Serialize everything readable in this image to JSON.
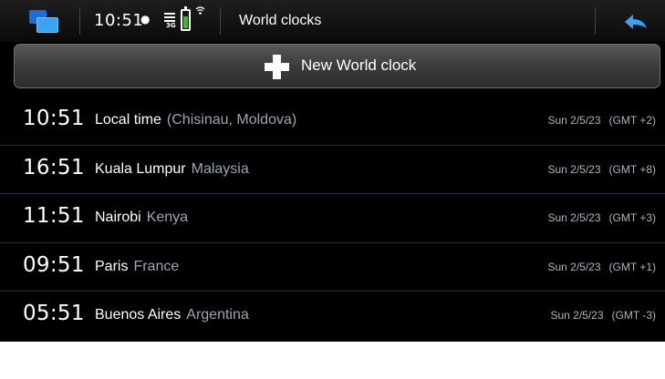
{
  "status_bar": {
    "clock": "10:51",
    "presence": "●",
    "network": "3G",
    "title": "World clocks",
    "icons": [
      "task-switcher-icon",
      "presence-icon",
      "signal-icon",
      "battery-icon",
      "wifi-icon",
      "back-arrow-icon"
    ]
  },
  "new_clock": {
    "label": "New World clock",
    "icon": "plus-icon"
  },
  "clocks": [
    {
      "time": "10:51",
      "city": "Local time",
      "country": "(Chisinau, Moldova)",
      "date": "Sun 2/5/23",
      "gmt": "(GMT +2)"
    },
    {
      "time": "16:51",
      "city": "Kuala Lumpur",
      "country": "Malaysia",
      "date": "Sun 2/5/23",
      "gmt": "(GMT +8)"
    },
    {
      "time": "11:51",
      "city": "Nairobi",
      "country": "Kenya",
      "date": "Sun 2/5/23",
      "gmt": "(GMT +3)"
    },
    {
      "time": "09:51",
      "city": "Paris",
      "country": "France",
      "date": "Sun 2/5/23",
      "gmt": "(GMT +1)"
    },
    {
      "time": "05:51",
      "city": "Buenos Aires",
      "country": "Argentina",
      "date": "Sun 2/5/23",
      "gmt": "(GMT -3)"
    }
  ],
  "colors": {
    "accent_blue": "#3aa3f2",
    "battery_green": "#35c21a",
    "background": "#000000"
  }
}
